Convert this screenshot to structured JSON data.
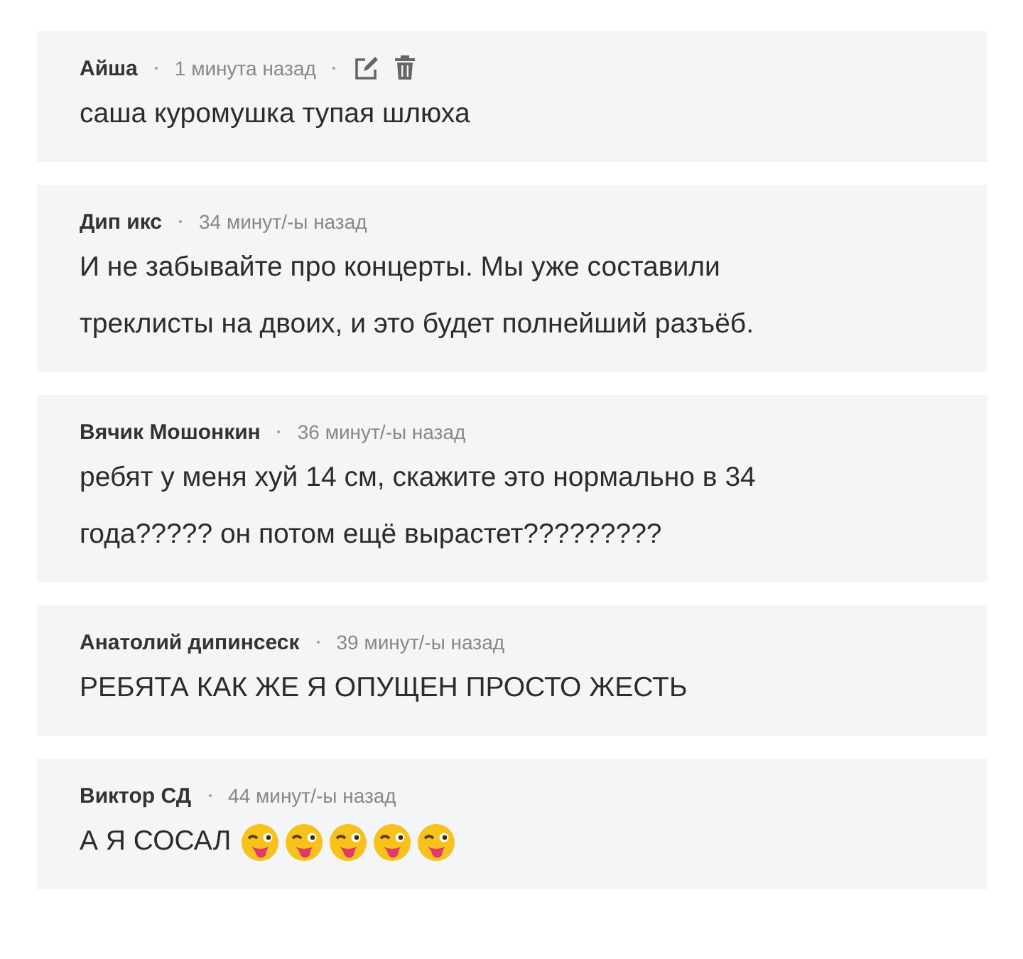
{
  "comments": [
    {
      "author": "Айша",
      "time": "1 минута назад",
      "actions": [
        {
          "kind": "edit"
        },
        {
          "kind": "delete"
        }
      ],
      "text": "саша куромушка тупая шлюха"
    },
    {
      "author": "Дип икс",
      "time": "34 минут/-ы назад",
      "text": "И не забывайте про концерты. Мы уже составили треклисты на двоих, и это будет полнейший разъёб."
    },
    {
      "author": "Вячик Мошонкин",
      "time": "36 минут/-ы назад",
      "text": "ребят у меня хуй 14 см, скажите это нормально в 34 года????? он потом ещё вырастет?????????"
    },
    {
      "author": "Анатолий дипинсеск",
      "time": "39 минут/-ы назад",
      "text": "РЕБЯТА КАК ЖЕ Я ОПУЩЕН ПРОСТО ЖЕСТЬ"
    },
    {
      "author": "Виктор СД",
      "time": "44 минут/-ы назад",
      "text": "А Я СОСАЛ",
      "emojis": [
        {
          "kind": "tongue-wink"
        },
        {
          "kind": "tongue-wink"
        },
        {
          "kind": "tongue-wink"
        },
        {
          "kind": "tongue-wink"
        },
        {
          "kind": "tongue-wink"
        }
      ]
    }
  ]
}
